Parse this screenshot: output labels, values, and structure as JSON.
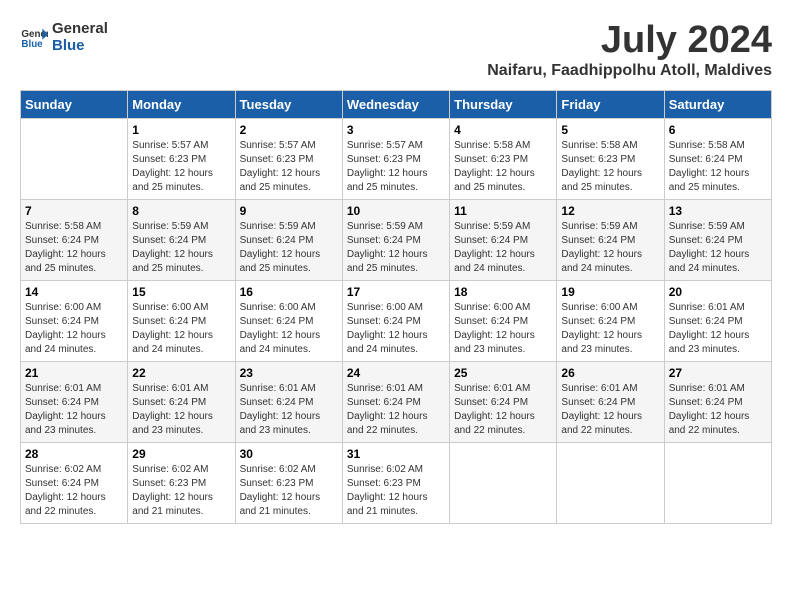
{
  "logo": {
    "text_general": "General",
    "text_blue": "Blue"
  },
  "title": "July 2024",
  "location": "Naifaru, Faadhippolhu Atoll, Maldives",
  "days_of_week": [
    "Sunday",
    "Monday",
    "Tuesday",
    "Wednesday",
    "Thursday",
    "Friday",
    "Saturday"
  ],
  "weeks": [
    [
      {
        "day": "",
        "sunrise": "",
        "sunset": "",
        "daylight": ""
      },
      {
        "day": "1",
        "sunrise": "Sunrise: 5:57 AM",
        "sunset": "Sunset: 6:23 PM",
        "daylight": "Daylight: 12 hours and 25 minutes."
      },
      {
        "day": "2",
        "sunrise": "Sunrise: 5:57 AM",
        "sunset": "Sunset: 6:23 PM",
        "daylight": "Daylight: 12 hours and 25 minutes."
      },
      {
        "day": "3",
        "sunrise": "Sunrise: 5:57 AM",
        "sunset": "Sunset: 6:23 PM",
        "daylight": "Daylight: 12 hours and 25 minutes."
      },
      {
        "day": "4",
        "sunrise": "Sunrise: 5:58 AM",
        "sunset": "Sunset: 6:23 PM",
        "daylight": "Daylight: 12 hours and 25 minutes."
      },
      {
        "day": "5",
        "sunrise": "Sunrise: 5:58 AM",
        "sunset": "Sunset: 6:23 PM",
        "daylight": "Daylight: 12 hours and 25 minutes."
      },
      {
        "day": "6",
        "sunrise": "Sunrise: 5:58 AM",
        "sunset": "Sunset: 6:24 PM",
        "daylight": "Daylight: 12 hours and 25 minutes."
      }
    ],
    [
      {
        "day": "7",
        "sunrise": "Sunrise: 5:58 AM",
        "sunset": "Sunset: 6:24 PM",
        "daylight": "Daylight: 12 hours and 25 minutes."
      },
      {
        "day": "8",
        "sunrise": "Sunrise: 5:59 AM",
        "sunset": "Sunset: 6:24 PM",
        "daylight": "Daylight: 12 hours and 25 minutes."
      },
      {
        "day": "9",
        "sunrise": "Sunrise: 5:59 AM",
        "sunset": "Sunset: 6:24 PM",
        "daylight": "Daylight: 12 hours and 25 minutes."
      },
      {
        "day": "10",
        "sunrise": "Sunrise: 5:59 AM",
        "sunset": "Sunset: 6:24 PM",
        "daylight": "Daylight: 12 hours and 25 minutes."
      },
      {
        "day": "11",
        "sunrise": "Sunrise: 5:59 AM",
        "sunset": "Sunset: 6:24 PM",
        "daylight": "Daylight: 12 hours and 24 minutes."
      },
      {
        "day": "12",
        "sunrise": "Sunrise: 5:59 AM",
        "sunset": "Sunset: 6:24 PM",
        "daylight": "Daylight: 12 hours and 24 minutes."
      },
      {
        "day": "13",
        "sunrise": "Sunrise: 5:59 AM",
        "sunset": "Sunset: 6:24 PM",
        "daylight": "Daylight: 12 hours and 24 minutes."
      }
    ],
    [
      {
        "day": "14",
        "sunrise": "Sunrise: 6:00 AM",
        "sunset": "Sunset: 6:24 PM",
        "daylight": "Daylight: 12 hours and 24 minutes."
      },
      {
        "day": "15",
        "sunrise": "Sunrise: 6:00 AM",
        "sunset": "Sunset: 6:24 PM",
        "daylight": "Daylight: 12 hours and 24 minutes."
      },
      {
        "day": "16",
        "sunrise": "Sunrise: 6:00 AM",
        "sunset": "Sunset: 6:24 PM",
        "daylight": "Daylight: 12 hours and 24 minutes."
      },
      {
        "day": "17",
        "sunrise": "Sunrise: 6:00 AM",
        "sunset": "Sunset: 6:24 PM",
        "daylight": "Daylight: 12 hours and 24 minutes."
      },
      {
        "day": "18",
        "sunrise": "Sunrise: 6:00 AM",
        "sunset": "Sunset: 6:24 PM",
        "daylight": "Daylight: 12 hours and 23 minutes."
      },
      {
        "day": "19",
        "sunrise": "Sunrise: 6:00 AM",
        "sunset": "Sunset: 6:24 PM",
        "daylight": "Daylight: 12 hours and 23 minutes."
      },
      {
        "day": "20",
        "sunrise": "Sunrise: 6:01 AM",
        "sunset": "Sunset: 6:24 PM",
        "daylight": "Daylight: 12 hours and 23 minutes."
      }
    ],
    [
      {
        "day": "21",
        "sunrise": "Sunrise: 6:01 AM",
        "sunset": "Sunset: 6:24 PM",
        "daylight": "Daylight: 12 hours and 23 minutes."
      },
      {
        "day": "22",
        "sunrise": "Sunrise: 6:01 AM",
        "sunset": "Sunset: 6:24 PM",
        "daylight": "Daylight: 12 hours and 23 minutes."
      },
      {
        "day": "23",
        "sunrise": "Sunrise: 6:01 AM",
        "sunset": "Sunset: 6:24 PM",
        "daylight": "Daylight: 12 hours and 23 minutes."
      },
      {
        "day": "24",
        "sunrise": "Sunrise: 6:01 AM",
        "sunset": "Sunset: 6:24 PM",
        "daylight": "Daylight: 12 hours and 22 minutes."
      },
      {
        "day": "25",
        "sunrise": "Sunrise: 6:01 AM",
        "sunset": "Sunset: 6:24 PM",
        "daylight": "Daylight: 12 hours and 22 minutes."
      },
      {
        "day": "26",
        "sunrise": "Sunrise: 6:01 AM",
        "sunset": "Sunset: 6:24 PM",
        "daylight": "Daylight: 12 hours and 22 minutes."
      },
      {
        "day": "27",
        "sunrise": "Sunrise: 6:01 AM",
        "sunset": "Sunset: 6:24 PM",
        "daylight": "Daylight: 12 hours and 22 minutes."
      }
    ],
    [
      {
        "day": "28",
        "sunrise": "Sunrise: 6:02 AM",
        "sunset": "Sunset: 6:24 PM",
        "daylight": "Daylight: 12 hours and 22 minutes."
      },
      {
        "day": "29",
        "sunrise": "Sunrise: 6:02 AM",
        "sunset": "Sunset: 6:23 PM",
        "daylight": "Daylight: 12 hours and 21 minutes."
      },
      {
        "day": "30",
        "sunrise": "Sunrise: 6:02 AM",
        "sunset": "Sunset: 6:23 PM",
        "daylight": "Daylight: 12 hours and 21 minutes."
      },
      {
        "day": "31",
        "sunrise": "Sunrise: 6:02 AM",
        "sunset": "Sunset: 6:23 PM",
        "daylight": "Daylight: 12 hours and 21 minutes."
      },
      {
        "day": "",
        "sunrise": "",
        "sunset": "",
        "daylight": ""
      },
      {
        "day": "",
        "sunrise": "",
        "sunset": "",
        "daylight": ""
      },
      {
        "day": "",
        "sunrise": "",
        "sunset": "",
        "daylight": ""
      }
    ]
  ]
}
